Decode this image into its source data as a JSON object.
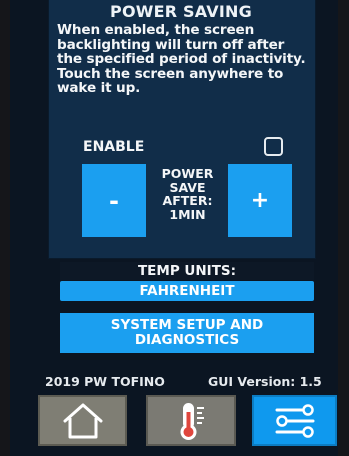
{
  "power_saving": {
    "title": "POWER SAVING",
    "description": "When enabled, the screen backlighting will turn off after the specified period of inactivity. Touch the screen anywhere to wake it up.",
    "enable_label": "ENABLE",
    "enabled": false,
    "decrease_label": "-",
    "increase_label": "+",
    "power_save_after": [
      "POWER",
      "SAVE",
      "AFTER:",
      "1MIN"
    ]
  },
  "temp_units": {
    "label": "TEMP UNITS:",
    "value": "FAHRENHEIT"
  },
  "system_setup": {
    "label_line1": "SYSTEM SETUP AND",
    "label_line2": "DIAGNOSTICS"
  },
  "footer": {
    "model": "2019 PW TOFINO",
    "gui_version": "GUI Version: 1.5"
  },
  "nav": {
    "items": [
      {
        "icon": "home-icon",
        "active": false
      },
      {
        "icon": "thermometer-icon",
        "active": false
      },
      {
        "icon": "settings-sliders-icon",
        "active": true
      }
    ]
  },
  "colors": {
    "accent": "#1b9ff0",
    "panel": "#112d49",
    "nav_inactive": "#7f7e74"
  }
}
